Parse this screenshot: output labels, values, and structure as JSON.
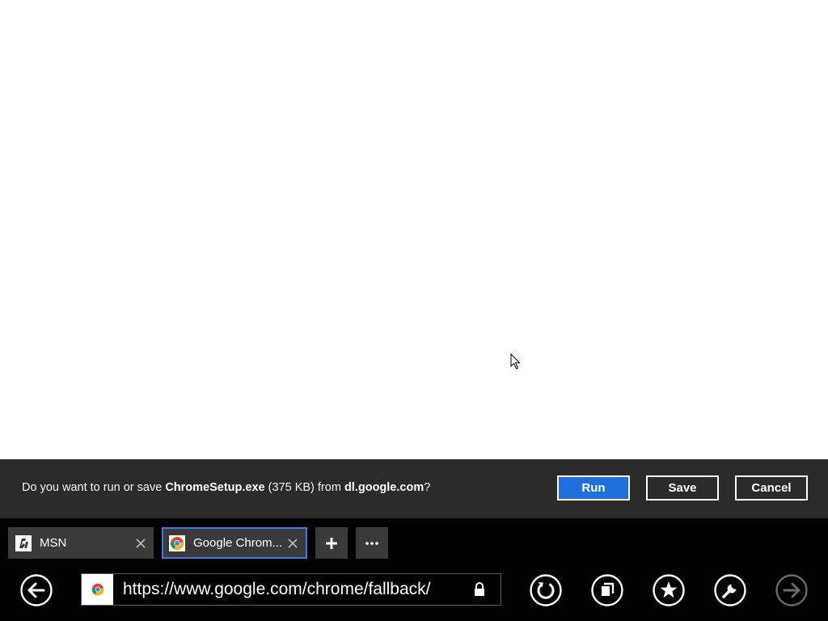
{
  "download": {
    "prefix": "Do you want to run or save ",
    "filename": "ChromeSetup.exe",
    "size": " (375 KB) from ",
    "domain": "dl.google.com",
    "suffix": "?",
    "run_label": "Run",
    "save_label": "Save",
    "cancel_label": "Cancel"
  },
  "tabs": [
    {
      "title": "MSN",
      "icon": "msn-icon",
      "active": false
    },
    {
      "title": "Google Chrom...",
      "icon": "chrome-icon",
      "active": true
    }
  ],
  "address": {
    "url": "https://www.google.com/chrome/fallback/",
    "secure": true
  },
  "icons": {
    "new_tab": "plus-icon",
    "more": "more-icon",
    "back": "back-arrow-icon",
    "refresh": "refresh-icon",
    "pages": "pin-icon",
    "favorites": "star-icon",
    "tools": "wrench-icon",
    "forward": "forward-arrow-icon"
  },
  "colors": {
    "download_bar_bg": "#2b2b2b",
    "primary_button": "#1e6fd9",
    "app_bar_bg": "#000000",
    "tab_bg": "#3a3a3a",
    "active_tab_border": "#3a7be8"
  }
}
